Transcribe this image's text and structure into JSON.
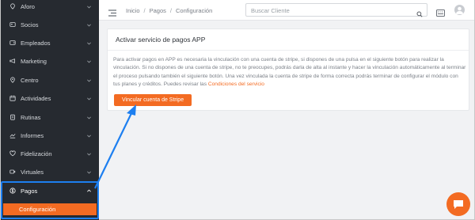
{
  "sidebar": {
    "items": [
      {
        "label": "Aforo",
        "icon": "pin-icon"
      },
      {
        "label": "Socios",
        "icon": "id-card-icon"
      },
      {
        "label": "Empleados",
        "icon": "id-badge-icon"
      },
      {
        "label": "Marketing",
        "icon": "megaphone-icon"
      },
      {
        "label": "Centro",
        "icon": "location-icon"
      },
      {
        "label": "Actividades",
        "icon": "calendar-icon"
      },
      {
        "label": "Rutinas",
        "icon": "clipboard-icon"
      },
      {
        "label": "Informes",
        "icon": "chart-icon"
      },
      {
        "label": "Fidelización",
        "icon": "heart-icon"
      },
      {
        "label": "Virtuales",
        "icon": "video-icon"
      }
    ],
    "active": {
      "label": "Pagos",
      "icon": "dollar-circle-icon"
    },
    "sub_active": {
      "label": "Configuración"
    }
  },
  "topbar": {
    "breadcrumb": [
      "Inicio",
      "Pagos",
      "Configuración"
    ],
    "search_placeholder": "Buscar Cliente"
  },
  "card": {
    "title": "Activar servicio de pagos APP",
    "body": "Para activar pagos en APP es necesaria la vinculación con una cuenta de stripe, si dispones de una pulsa en el siguiente botón para realizar la vinculación. Si no dispones de una cuenta de stripe, no te preocupes, podrás darla de alta al instante y hacer la vinculación automáticamente al terminar el proceso pulsando también el siguiente botón. Una vez vinculada la cuenta de stripe de forma correcta podrás terminar de configurar el módulo con tus planes y créditos. Puedes revisar las ",
    "link": "Condiciones del servicio",
    "button": "Vincular cuenta de Stripe"
  },
  "colors": {
    "accent": "#f36b22",
    "sidebar_bg": "#262a30",
    "annotation": "#1d7ff0"
  }
}
